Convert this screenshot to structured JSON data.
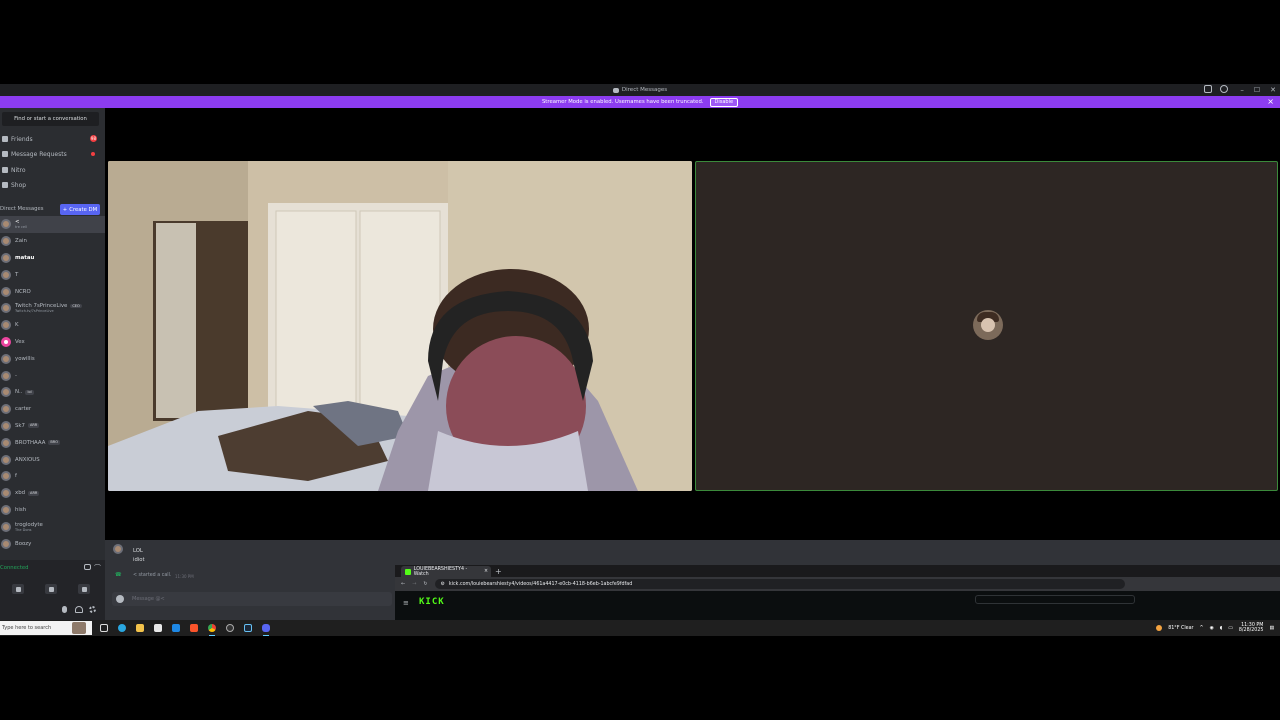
{
  "window": {
    "title": "Direct Messages"
  },
  "banner": {
    "text": "Streamer Mode is enabled. Usernames have been truncated.",
    "disable_label": "Disable"
  },
  "sidebar": {
    "search_label": "Find or start a conversation",
    "nav": [
      {
        "label": "Friends",
        "badge": "98"
      },
      {
        "label": "Message Requests",
        "badge": ""
      },
      {
        "label": "Nitro",
        "badge": ""
      },
      {
        "label": "Shop",
        "badge": ""
      }
    ],
    "dm_header": "Direct Messages",
    "create_dm_label": "Create DM",
    "dms": [
      {
        "name": "<",
        "sub": "tre cell",
        "tag": ""
      },
      {
        "name": "Zain",
        "sub": "",
        "tag": ""
      },
      {
        "name": "matau",
        "sub": "",
        "tag": ""
      },
      {
        "name": "T",
        "sub": "",
        "tag": ""
      },
      {
        "name": "NCRO",
        "sub": "",
        "tag": ""
      },
      {
        "name": "Twitch 7sPrinceLive",
        "sub": "Twitch.tv/7sPrinceLive",
        "tag": "CEO"
      },
      {
        "name": "K",
        "sub": "",
        "tag": ""
      },
      {
        "name": "Vex",
        "sub": "",
        "tag": ""
      },
      {
        "name": "yowillis",
        "sub": "",
        "tag": ""
      },
      {
        "name": "-",
        "sub": "",
        "tag": ""
      },
      {
        "name": "N..",
        "sub": "",
        "tag": "lol"
      },
      {
        "name": "carter",
        "sub": "",
        "tag": ""
      },
      {
        "name": "Sk7",
        "sub": "",
        "tag": "ARR"
      },
      {
        "name": "BROTHAAA",
        "sub": "",
        "tag": "BRO"
      },
      {
        "name": "ANXIOUS",
        "sub": "",
        "tag": ""
      },
      {
        "name": "f",
        "sub": "",
        "tag": ""
      },
      {
        "name": "xbd",
        "sub": "",
        "tag": "ARR"
      },
      {
        "name": "hish",
        "sub": "",
        "tag": ""
      },
      {
        "name": "troglodyte",
        "sub": "The Dons",
        "tag": ""
      },
      {
        "name": "Boozy",
        "sub": "",
        "tag": ""
      }
    ],
    "voice_status": "Connected"
  },
  "chat": {
    "messages": [
      "LOL",
      "idiot"
    ],
    "call_notice": "< started a call.",
    "call_time": "11:30 PM",
    "input_placeholder": "Message @<"
  },
  "browser": {
    "tab_title": "LOUIEBEARSHIESTY4 - Watch",
    "url": "kick.com/louiebearshiesty4/videos/461a4417-e0cb-4118-b6eb-1abcfe9fdfad",
    "logo_text": "KICK"
  },
  "taskbar": {
    "search_placeholder": "Type here to search",
    "weather": "81°F Clear",
    "time": "11:30 PM",
    "date": "8/28/2025"
  },
  "colors": {
    "streamer_banner": "#8c3cf0",
    "kick_green": "#53fc18",
    "speaking_border": "#3b8a3b"
  }
}
